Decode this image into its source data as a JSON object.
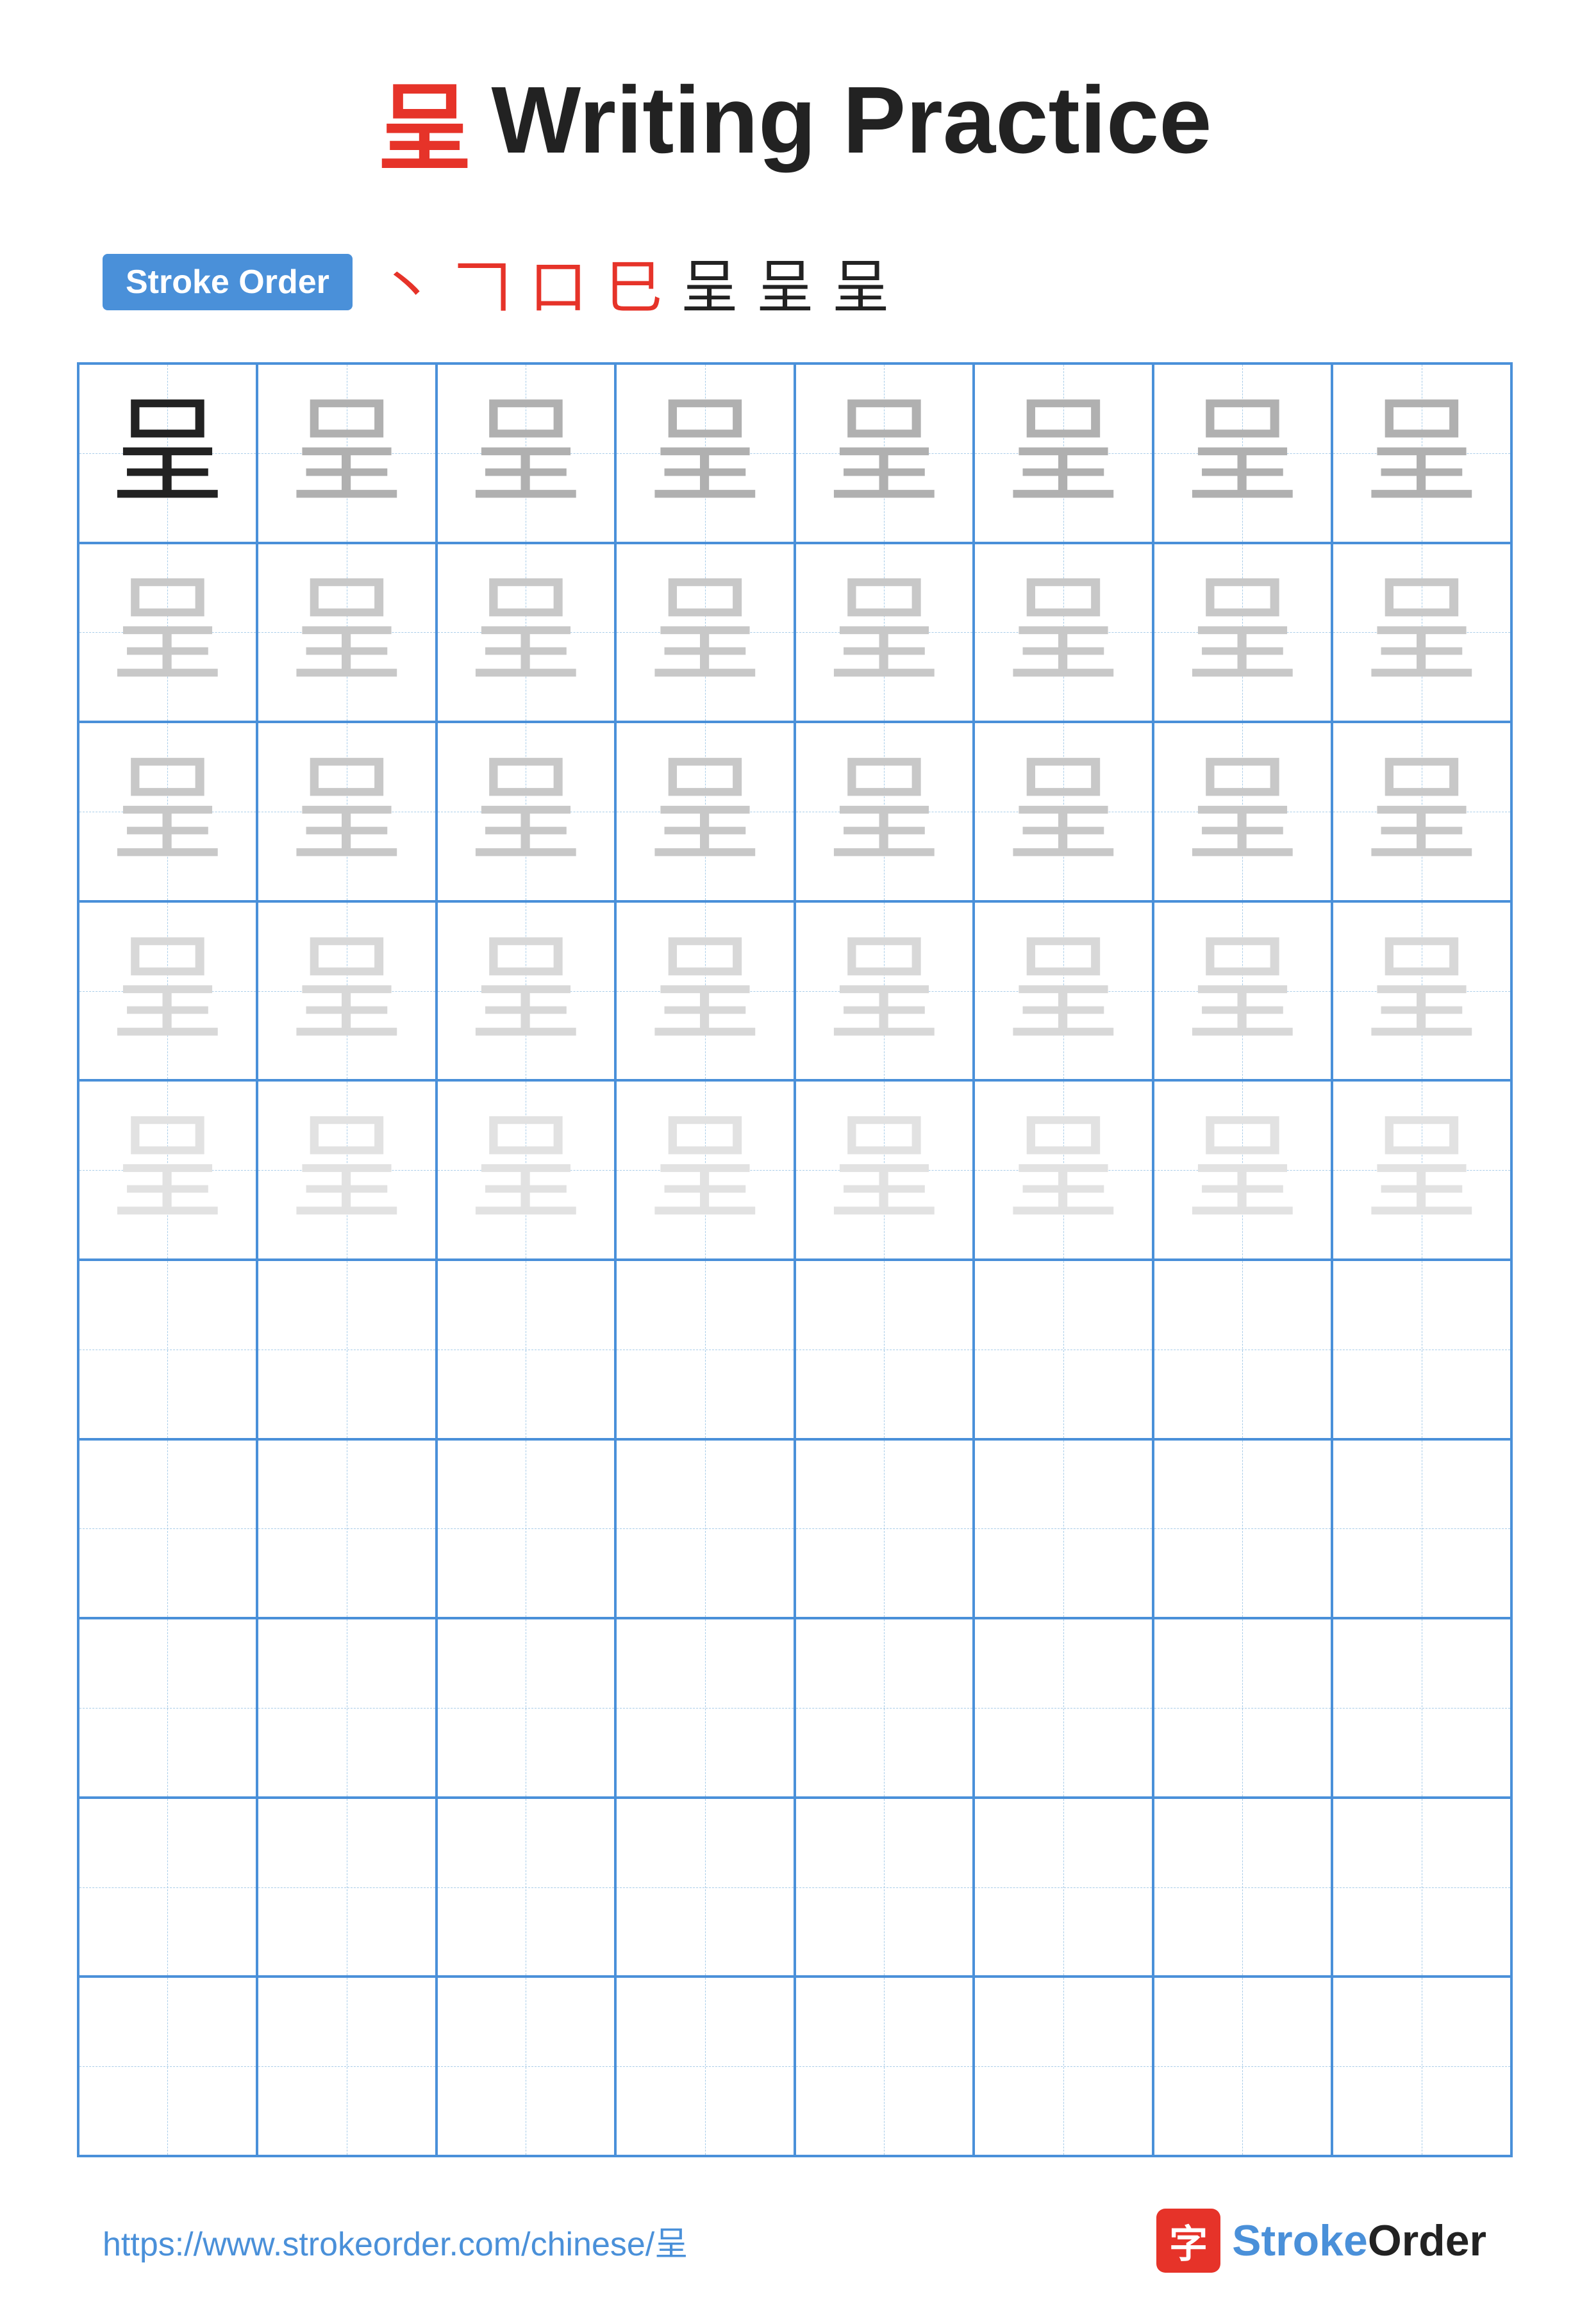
{
  "title": {
    "char": "呈",
    "text": "Writing Practice"
  },
  "stroke_order": {
    "badge_label": "Stroke Order",
    "chars": [
      "丶",
      "コ",
      "口",
      "已",
      "呈",
      "呈",
      "呈"
    ]
  },
  "grid": {
    "rows": 10,
    "cols": 8,
    "main_char": "呈"
  },
  "footer": {
    "url": "https://www.strokeorder.com/chinese/呈",
    "logo_char": "字",
    "logo_name_stroke": "Stroke",
    "logo_name_order": "Order"
  },
  "cell_opacities": [
    "dark",
    "light1",
    "light1",
    "light1",
    "light1",
    "light1",
    "light1",
    "light1",
    "light2",
    "light2",
    "light2",
    "light2",
    "light2",
    "light2",
    "light2",
    "light2",
    "light2",
    "light2",
    "light2",
    "light2",
    "light2",
    "light2",
    "light2",
    "light2",
    "light3",
    "light3",
    "light3",
    "light3",
    "light3",
    "light3",
    "light3",
    "light3",
    "light4",
    "light4",
    "light4",
    "light4",
    "light4",
    "light4",
    "light4",
    "light4",
    "empty",
    "empty",
    "empty",
    "empty",
    "empty",
    "empty",
    "empty",
    "empty",
    "empty",
    "empty",
    "empty",
    "empty",
    "empty",
    "empty",
    "empty",
    "empty",
    "empty",
    "empty",
    "empty",
    "empty",
    "empty",
    "empty",
    "empty",
    "empty",
    "empty",
    "empty",
    "empty",
    "empty",
    "empty",
    "empty",
    "empty",
    "empty",
    "empty",
    "empty",
    "empty",
    "empty",
    "empty",
    "empty",
    "empty",
    "empty"
  ]
}
